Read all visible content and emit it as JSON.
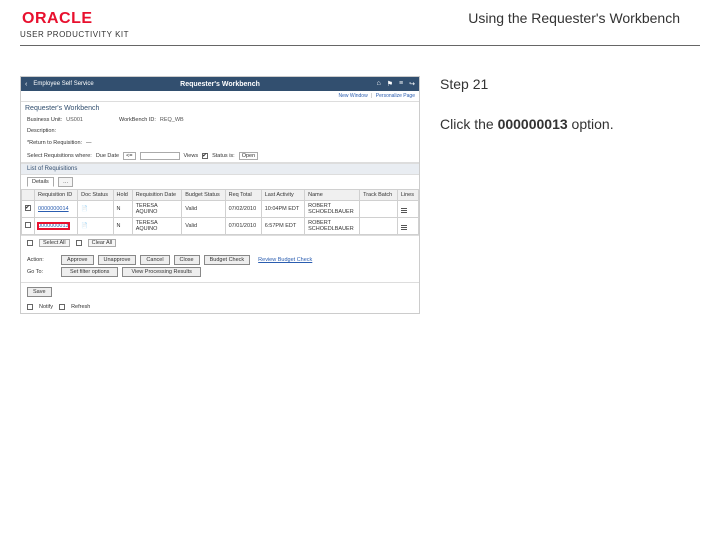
{
  "header": {
    "brand": "ORACLE",
    "product": "USER PRODUCTIVITY KIT",
    "doc_title": "Using the Requester's Workbench"
  },
  "instructions": {
    "step_label": "Step 21",
    "click_prefix": "Click the ",
    "click_target": "000000013",
    "click_suffix": " option."
  },
  "app": {
    "back_label": "Employee Self Service",
    "title": "Requester's Workbench",
    "sublinks": {
      "a": "New Window",
      "b": "Personalize Page"
    },
    "page_title": "Requester's Workbench",
    "params": {
      "bu_label": "Business Unit:",
      "bu_value": "US001",
      "wb_label": "WorkBench ID:",
      "wb_value": "REQ_WB",
      "desc_label": "Description:",
      "desc_value": "",
      "rtn_label": "*Return to Requisition:",
      "rtn_value": "—"
    },
    "filter": {
      "label": "Select Requisitions where:",
      "due_label": "Due Date",
      "le": "<=",
      "views": "Views",
      "status_lbl": "Status is:",
      "open": "Open"
    },
    "section": "List of Requisitions",
    "tabs": {
      "details": "Details",
      "more": "…"
    },
    "columns": {
      "c1": "Requisition ID",
      "c2": "Doc Status",
      "c3": "Hold",
      "c4": "Requisition Date",
      "c5": "Budget Status",
      "c6": "Req Total",
      "c7": "Last Activity",
      "c8": "Name",
      "c9": "Track Batch",
      "c10": "Lines"
    },
    "rows": [
      {
        "checked": true,
        "req_id": "0000000014",
        "doc_status_icon": true,
        "hold": "N",
        "req_date_1": "TERESA",
        "req_date_2": "AQUINO",
        "budget": "Valid",
        "total": "07/02/2010",
        "last": "10:04PM EDT",
        "name_1": "ROBERT",
        "name_2": "SCHOEDLBAUER",
        "track": ""
      },
      {
        "checked": false,
        "req_id": "0000000013",
        "doc_status_icon": true,
        "hold": "N",
        "req_date_1": "TERESA",
        "req_date_2": "AQUINO",
        "budget": "Valid",
        "total": "07/01/2010",
        "last": "6:57PM EDT",
        "name_1": "ROBERT",
        "name_2": "SCHOEDLBAUER",
        "track": ""
      }
    ],
    "footer_sel": {
      "select_all": "Select All",
      "clear_all": "Clear All"
    },
    "actions": {
      "label": "Action:",
      "approve": "Approve",
      "unapprove": "Unapprove",
      "cancel": "Cancel",
      "close": "Close",
      "budget": "Budget Check",
      "goto_label": "Go To:",
      "set_filter": "Set filter options",
      "view_pc": "View Processing Results",
      "review": "Review Budget Check"
    },
    "save_row": {
      "save": "Save"
    },
    "notify_row": {
      "notify": "Notify",
      "refresh": "Refresh"
    }
  }
}
